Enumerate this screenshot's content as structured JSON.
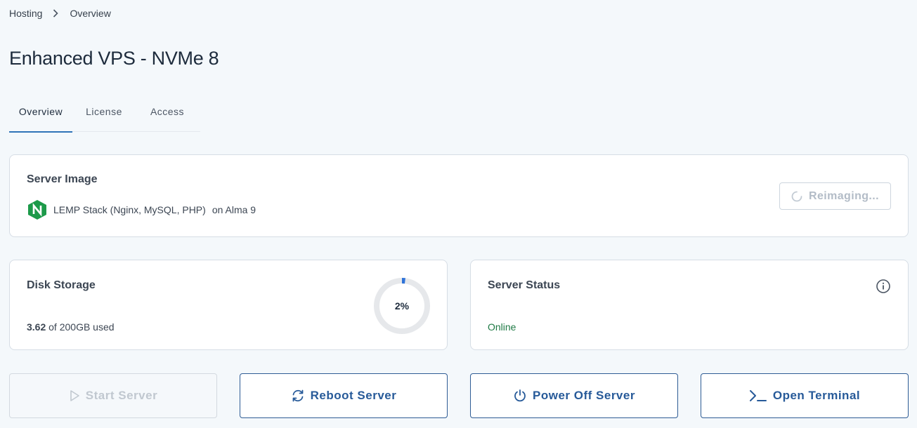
{
  "breadcrumb": {
    "parent": "Hosting",
    "current": "Overview"
  },
  "page": {
    "title": "Enhanced VPS - NVMe 8"
  },
  "tabs": [
    {
      "label": "Overview",
      "active": true
    },
    {
      "label": "License",
      "active": false
    },
    {
      "label": "Access",
      "active": false
    }
  ],
  "server_image": {
    "title": "Server Image",
    "stack": "LEMP Stack (Nginx, MySQL, PHP)",
    "os": "on Alma 9",
    "icon": "nginx-logo",
    "reimage_label": "Reimaging..."
  },
  "disk": {
    "title": "Disk Storage",
    "used": "3.62",
    "total_text": "of 200GB used",
    "percent_label": "2%",
    "percent_value": 2
  },
  "status": {
    "title": "Server Status",
    "value": "Online"
  },
  "actions": {
    "start": "Start Server",
    "reboot": "Reboot Server",
    "power_off": "Power Off Server",
    "terminal": "Open Terminal"
  },
  "colors": {
    "accent": "#2f73b8",
    "action_text": "#275a99",
    "online": "#1f7a45",
    "nginx_green": "#1d9a4a"
  }
}
